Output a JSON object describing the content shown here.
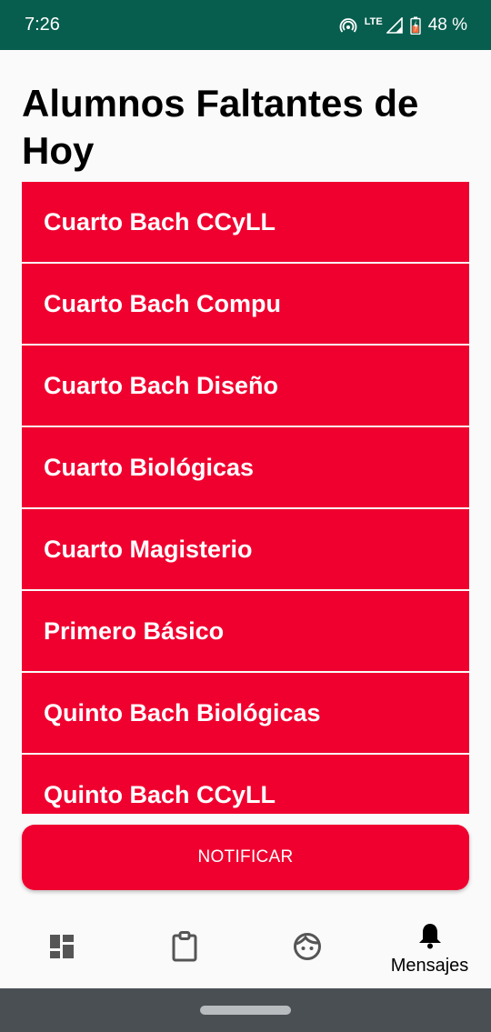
{
  "status_bar": {
    "time": "7:26",
    "network": "LTE",
    "battery": "48 %",
    "icons": [
      "hotspot-icon",
      "signal-icon",
      "battery-icon"
    ]
  },
  "page": {
    "title": "Alumnos Faltantes de Hoy"
  },
  "list": {
    "items": [
      "Cuarto Bach CCyLL",
      "Cuarto Bach Compu",
      "Cuarto Bach Diseño",
      "Cuarto Biológicas",
      "Cuarto Magisterio",
      "Primero Básico",
      "Quinto Bach Biológicas",
      "Quinto Bach CCyLL"
    ]
  },
  "actions": {
    "notify_label": "NOTIFICAR"
  },
  "bottom_nav": {
    "items": [
      {
        "icon": "dashboard-icon",
        "label": ""
      },
      {
        "icon": "clipboard-icon",
        "label": ""
      },
      {
        "icon": "face-icon",
        "label": ""
      },
      {
        "icon": "bell-icon",
        "label": "Mensajes"
      }
    ]
  },
  "colors": {
    "status_bar": "#075e4e",
    "accent": "#f0002f",
    "background": "#fafafa",
    "system_nav": "#4a4f54"
  }
}
